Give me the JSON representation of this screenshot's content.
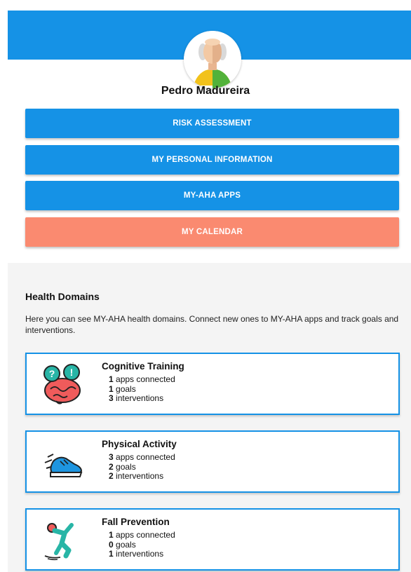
{
  "profile": {
    "name": "Pedro Madureira",
    "avatar_icon": "elderly-man-avatar-icon"
  },
  "menu": {
    "risk_assessment": "RISK ASSESSMENT",
    "personal_info": "MY PERSONAL INFORMATION",
    "apps": "MY-AHA APPS",
    "calendar": "MY CALENDAR"
  },
  "colors": {
    "primary": "#1592e6",
    "coral": "#fa8a70",
    "section_bg": "#f4f4f4"
  },
  "health_domains": {
    "title": "Health Domains",
    "description": "Here you can see MY-AHA health domains. Connect new ones to MY-AHA apps and track goals and interventions.",
    "items": [
      {
        "title": "Cognitive Training",
        "icon": "brain-icon",
        "apps": "1",
        "apps_label": "apps connected",
        "goals": "1",
        "goals_label": "goals",
        "interventions": "3",
        "interventions_label": "interventions"
      },
      {
        "title": "Physical Activity",
        "icon": "running-shoe-icon",
        "apps": "3",
        "apps_label": "apps connected",
        "goals": "2",
        "goals_label": "goals",
        "interventions": "2",
        "interventions_label": "interventions"
      },
      {
        "title": "Fall Prevention",
        "icon": "falling-person-icon",
        "apps": "1",
        "apps_label": "apps connected",
        "goals": "0",
        "goals_label": "goals",
        "interventions": "1",
        "interventions_label": "interventions"
      }
    ]
  }
}
